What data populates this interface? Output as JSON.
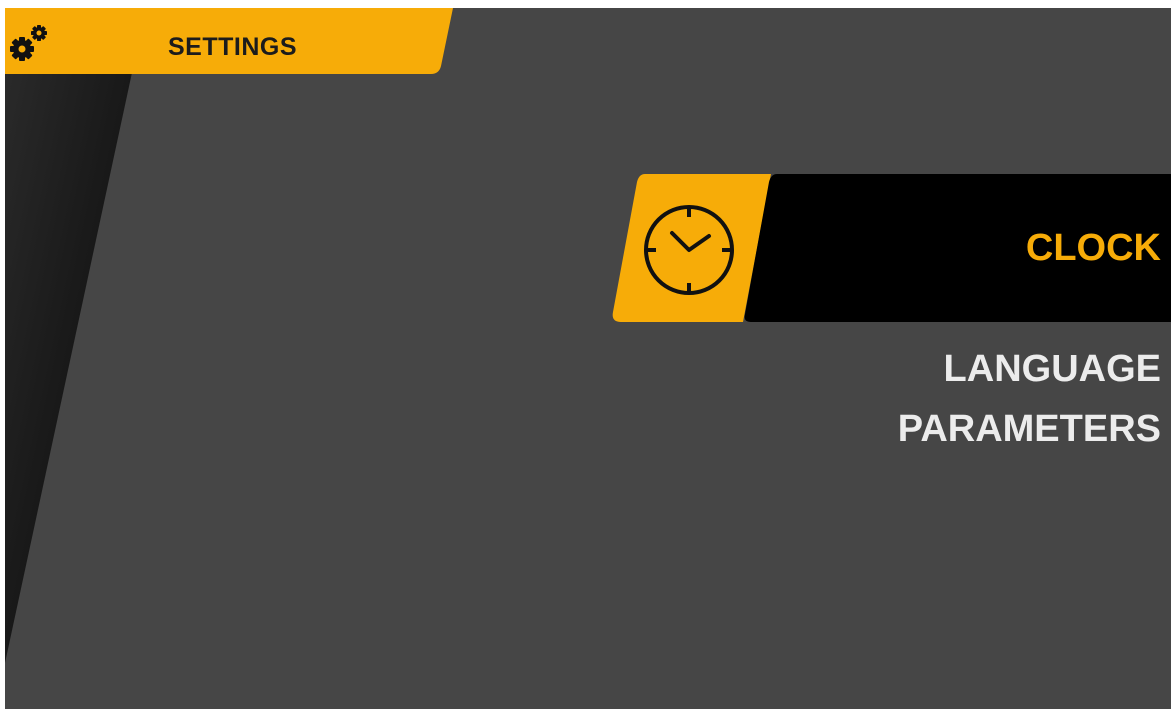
{
  "header": {
    "title": "SETTINGS",
    "icon": "gears-icon"
  },
  "menu": {
    "selected": {
      "label": "CLOCK",
      "icon": "clock-icon"
    },
    "items": [
      {
        "label": "LANGUAGE"
      },
      {
        "label": "PARAMETERS"
      }
    ]
  },
  "colors": {
    "accent": "#f7ac08",
    "background": "#464646",
    "selected_bg": "#000000",
    "text": "#ececec"
  }
}
